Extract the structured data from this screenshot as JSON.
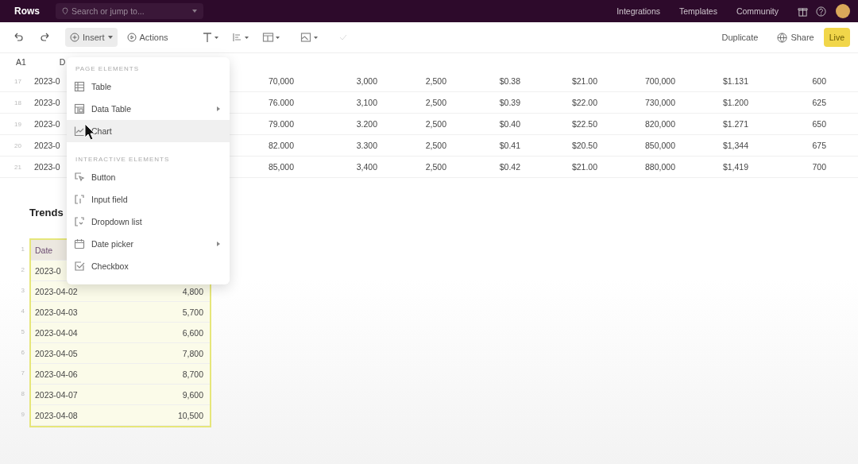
{
  "topbar": {
    "logo": "Rows",
    "search": {
      "placeholder": "Search or jump to..."
    },
    "links": [
      "Integrations",
      "Templates",
      "Community"
    ]
  },
  "toolbar": {
    "insert": {
      "label": "Insert",
      "open": true
    },
    "actions": "Actions",
    "duplicate": "Duplicate",
    "share": "Share",
    "live": "Live"
  },
  "formula_bar": {
    "cell_ref": "A1",
    "value": "D"
  },
  "top_table": {
    "rows": [
      {
        "row": "17",
        "cells": [
          "2023-0",
          "70,000",
          "3,000",
          "2,500",
          "$0.38",
          "$21.00",
          "700,000",
          "$1.131",
          "600"
        ]
      },
      {
        "row": "18",
        "cells": [
          "2023-0",
          "76.000",
          "3,100",
          "2,500",
          "$0.39",
          "$22.00",
          "730,000",
          "$1.200",
          "625"
        ]
      },
      {
        "row": "19",
        "cells": [
          "2023-0",
          "79.000",
          "3.200",
          "2,500",
          "$0.40",
          "$22.50",
          "820,000",
          "$1.271",
          "650"
        ]
      },
      {
        "row": "20",
        "cells": [
          "2023-0",
          "82.000",
          "3.300",
          "2,500",
          "$0.41",
          "$20.50",
          "850,000",
          "$1,344",
          "675"
        ]
      },
      {
        "row": "21",
        "cells": [
          "2023-0",
          "85,000",
          "3,400",
          "2,500",
          "$0.42",
          "$21.00",
          "880,000",
          "$1,419",
          "700"
        ]
      }
    ]
  },
  "trends": {
    "title": "Trends",
    "selected": true,
    "header": {
      "row": "1",
      "cells": [
        "Date"
      ]
    },
    "rows": [
      {
        "row": "2",
        "cells": [
          "2023-0"
        ]
      },
      {
        "row": "3",
        "cells": [
          "2023-04-02",
          "4,800"
        ]
      },
      {
        "row": "4",
        "cells": [
          "2023-04-03",
          "5,700"
        ]
      },
      {
        "row": "5",
        "cells": [
          "2023-04-04",
          "6,600"
        ]
      },
      {
        "row": "6",
        "cells": [
          "2023-04-05",
          "7,800"
        ]
      },
      {
        "row": "7",
        "cells": [
          "2023-04-06",
          "8,700"
        ]
      },
      {
        "row": "8",
        "cells": [
          "2023-04-07",
          "9,600"
        ]
      },
      {
        "row": "9",
        "cells": [
          "2023-04-08",
          "10,500"
        ]
      }
    ]
  },
  "insert_menu": {
    "sections": [
      {
        "heading": "PAGE ELEMENTS",
        "items": [
          {
            "label": "Table",
            "kind": "table",
            "submenu": false,
            "selected": false
          },
          {
            "label": "Data Table",
            "kind": "datatable",
            "submenu": true,
            "selected": false
          },
          {
            "label": "Chart",
            "kind": "chart",
            "submenu": false,
            "selected": true
          }
        ]
      },
      {
        "heading": "INTERACTIVE ELEMENTS",
        "items": [
          {
            "label": "Button",
            "kind": "button",
            "submenu": false,
            "selected": false
          },
          {
            "label": "Input field",
            "kind": "input",
            "submenu": false,
            "selected": false
          },
          {
            "label": "Dropdown list",
            "kind": "dropdown",
            "submenu": false,
            "selected": false
          },
          {
            "label": "Date picker",
            "kind": "date",
            "submenu": true,
            "selected": false
          },
          {
            "label": "Checkbox",
            "kind": "checkbox",
            "submenu": false,
            "selected": false
          }
        ]
      }
    ]
  }
}
